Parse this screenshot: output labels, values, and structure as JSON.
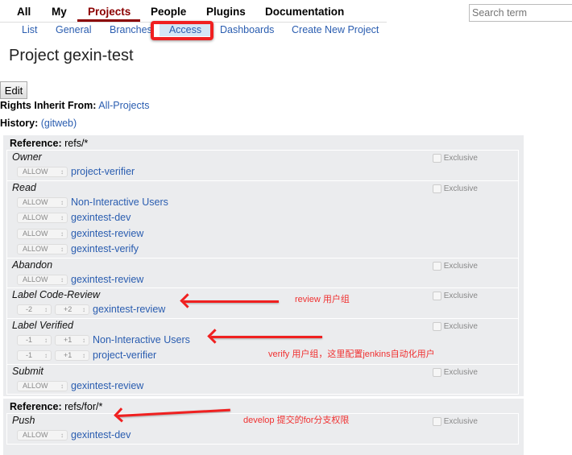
{
  "nav": {
    "tabs": [
      {
        "label": "All"
      },
      {
        "label": "My"
      },
      {
        "label": "Projects",
        "active": true
      },
      {
        "label": "People"
      },
      {
        "label": "Plugins"
      },
      {
        "label": "Documentation"
      }
    ],
    "subtabs": [
      {
        "label": "List"
      },
      {
        "label": "General"
      },
      {
        "label": "Branches"
      },
      {
        "label": "Access",
        "active": true
      },
      {
        "label": "Dashboards"
      },
      {
        "label": "Create New Project"
      }
    ],
    "search_placeholder": "Search term"
  },
  "page": {
    "title": "Project gexin-test",
    "edit_label": "Edit",
    "inherit_label": "Rights Inherit From:",
    "inherit_value": "All-Projects",
    "history_label": "History:",
    "history_value": "(gitweb)",
    "exclusive_label": "Exclusive"
  },
  "references": [
    {
      "label": "Reference:",
      "name": "refs/*",
      "permissions": [
        {
          "name": "Owner",
          "rules": [
            {
              "action": "ALLOW",
              "group": "project-verifier"
            }
          ]
        },
        {
          "name": "Read",
          "rules": [
            {
              "action": "ALLOW",
              "group": "Non-Interactive Users"
            },
            {
              "action": "ALLOW",
              "group": "gexintest-dev"
            },
            {
              "action": "ALLOW",
              "group": "gexintest-review"
            },
            {
              "action": "ALLOW",
              "group": "gexintest-verify"
            }
          ]
        },
        {
          "name": "Abandon",
          "rules": [
            {
              "action": "ALLOW",
              "group": "gexintest-review"
            }
          ]
        },
        {
          "name": "Label Code-Review",
          "rules": [
            {
              "min": "-2",
              "max": "+2",
              "group": "gexintest-review"
            }
          ]
        },
        {
          "name": "Label Verified",
          "rules": [
            {
              "min": "-1",
              "max": "+1",
              "group": "Non-Interactive Users"
            },
            {
              "min": "-1",
              "max": "+1",
              "group": "project-verifier"
            }
          ]
        },
        {
          "name": "Submit",
          "rules": [
            {
              "action": "ALLOW",
              "group": "gexintest-review"
            }
          ]
        }
      ]
    },
    {
      "label": "Reference:",
      "name": "refs/for/*",
      "permissions": [
        {
          "name": "Push",
          "rules": [
            {
              "action": "ALLOW",
              "group": "gexintest-dev"
            }
          ]
        }
      ]
    }
  ],
  "annotations": [
    "review 用户组",
    "verify 用户组，这里配置jenkins自动化用户",
    "develop 提交的for分支权限"
  ],
  "colors": {
    "link": "#2a5db0",
    "active_tab": "#8b0000",
    "highlight": "#f02020",
    "annotation": "#f03030"
  }
}
